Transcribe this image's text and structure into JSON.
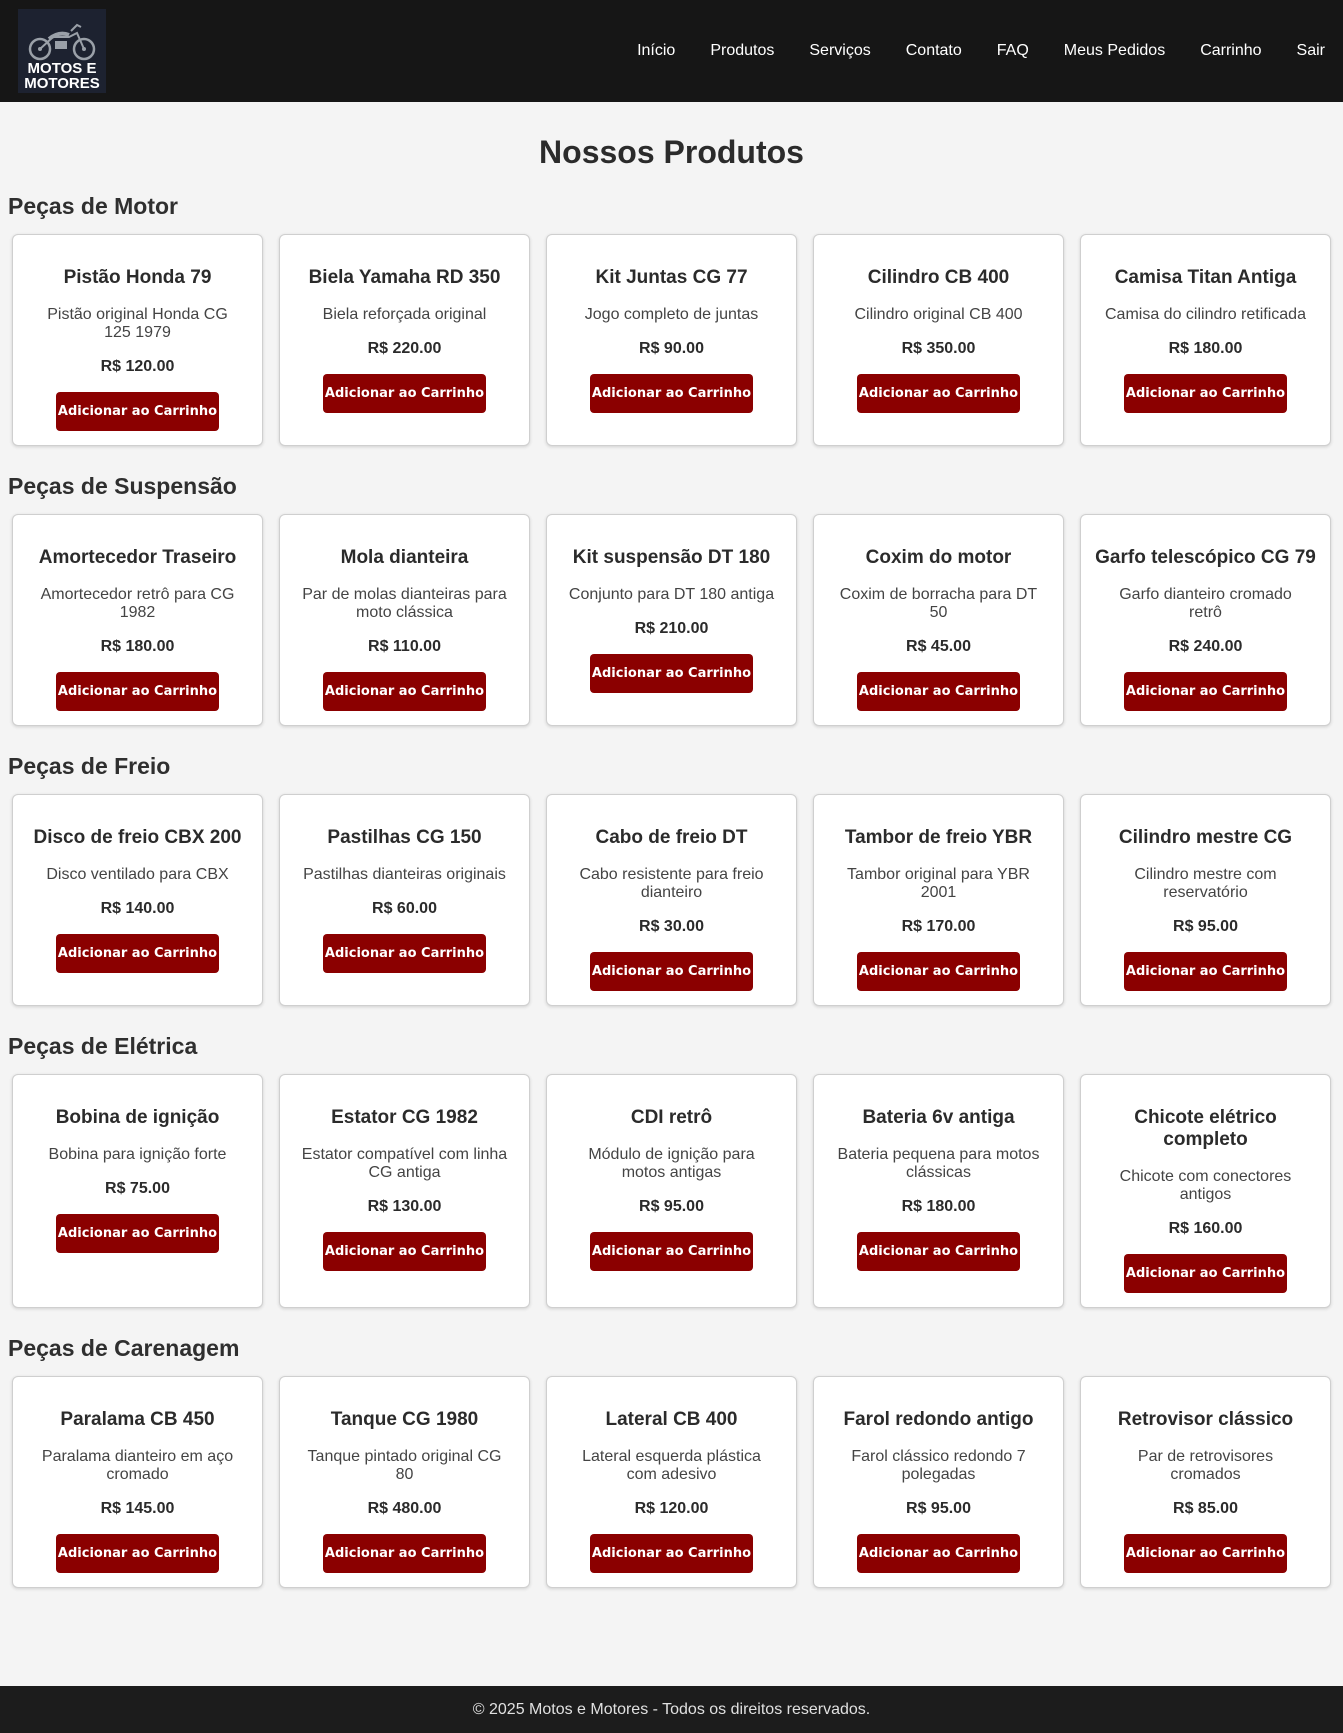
{
  "logo": {
    "line1": "MOTOS E",
    "line2": "MOTORES"
  },
  "nav": [
    {
      "label": "Início",
      "name": "nav-inicio"
    },
    {
      "label": "Produtos",
      "name": "nav-produtos"
    },
    {
      "label": "Serviços",
      "name": "nav-servicos"
    },
    {
      "label": "Contato",
      "name": "nav-contato"
    },
    {
      "label": "FAQ",
      "name": "nav-faq"
    },
    {
      "label": "Meus Pedidos",
      "name": "nav-meus-pedidos"
    },
    {
      "label": "Carrinho",
      "name": "nav-carrinho"
    },
    {
      "label": "Sair",
      "name": "nav-sair"
    }
  ],
  "page_title": "Nossos Produtos",
  "button_label": "Adicionar ao Carrinho",
  "categories": [
    {
      "title": "Peças de Motor",
      "products": [
        {
          "name": "Pistão Honda 79",
          "desc": "Pistão original Honda CG 125 1979",
          "price": "R$ 120.00"
        },
        {
          "name": "Biela Yamaha RD 350",
          "desc": "Biela reforçada original",
          "price": "R$ 220.00"
        },
        {
          "name": "Kit Juntas CG 77",
          "desc": "Jogo completo de juntas",
          "price": "R$ 90.00"
        },
        {
          "name": "Cilindro CB 400",
          "desc": "Cilindro original CB 400",
          "price": "R$ 350.00"
        },
        {
          "name": "Camisa Titan Antiga",
          "desc": "Camisa do cilindro retificada",
          "price": "R$ 180.00"
        }
      ]
    },
    {
      "title": "Peças de Suspensão",
      "products": [
        {
          "name": "Amortecedor Traseiro",
          "desc": "Amortecedor retrô para CG 1982",
          "price": "R$ 180.00"
        },
        {
          "name": "Mola dianteira",
          "desc": "Par de molas dianteiras para moto clássica",
          "price": "R$ 110.00"
        },
        {
          "name": "Kit suspensão DT 180",
          "desc": "Conjunto para DT 180 antiga",
          "price": "R$ 210.00"
        },
        {
          "name": "Coxim do motor",
          "desc": "Coxim de borracha para DT 50",
          "price": "R$ 45.00"
        },
        {
          "name": "Garfo telescópico CG 79",
          "desc": "Garfo dianteiro cromado retrô",
          "price": "R$ 240.00"
        }
      ]
    },
    {
      "title": "Peças de Freio",
      "products": [
        {
          "name": "Disco de freio CBX 200",
          "desc": "Disco ventilado para CBX",
          "price": "R$ 140.00"
        },
        {
          "name": "Pastilhas CG 150",
          "desc": "Pastilhas dianteiras originais",
          "price": "R$ 60.00"
        },
        {
          "name": "Cabo de freio DT",
          "desc": "Cabo resistente para freio dianteiro",
          "price": "R$ 30.00"
        },
        {
          "name": "Tambor de freio YBR",
          "desc": "Tambor original para YBR 2001",
          "price": "R$ 170.00"
        },
        {
          "name": "Cilindro mestre CG",
          "desc": "Cilindro mestre com reservatório",
          "price": "R$ 95.00"
        }
      ]
    },
    {
      "title": "Peças de Elétrica",
      "products": [
        {
          "name": "Bobina de ignição",
          "desc": "Bobina para ignição forte",
          "price": "R$ 75.00"
        },
        {
          "name": "Estator CG 1982",
          "desc": "Estator compatível com linha CG antiga",
          "price": "R$ 130.00"
        },
        {
          "name": "CDI retrô",
          "desc": "Módulo de ignição para motos antigas",
          "price": "R$ 95.00"
        },
        {
          "name": "Bateria 6v antiga",
          "desc": "Bateria pequena para motos clássicas",
          "price": "R$ 180.00"
        },
        {
          "name": "Chicote elétrico completo",
          "desc": "Chicote com conectores antigos",
          "price": "R$ 160.00"
        }
      ]
    },
    {
      "title": "Peças de Carenagem",
      "products": [
        {
          "name": "Paralama CB 450",
          "desc": "Paralama dianteiro em aço cromado",
          "price": "R$ 145.00"
        },
        {
          "name": "Tanque CG 1980",
          "desc": "Tanque pintado original CG 80",
          "price": "R$ 480.00"
        },
        {
          "name": "Lateral CB 400",
          "desc": "Lateral esquerda plástica com adesivo",
          "price": "R$ 120.00"
        },
        {
          "name": "Farol redondo antigo",
          "desc": "Farol clássico redondo 7 polegadas",
          "price": "R$ 95.00"
        },
        {
          "name": "Retrovisor clássico",
          "desc": "Par de retrovisores cromados",
          "price": "R$ 85.00"
        }
      ]
    }
  ],
  "footer": "© 2025 Motos e Motores - Todos os direitos reservados.",
  "colors": {
    "header_bg": "#161616",
    "button_bg": "#8b0000",
    "page_bg": "#f4f4f4",
    "footer_bg": "#1c1c1c"
  }
}
